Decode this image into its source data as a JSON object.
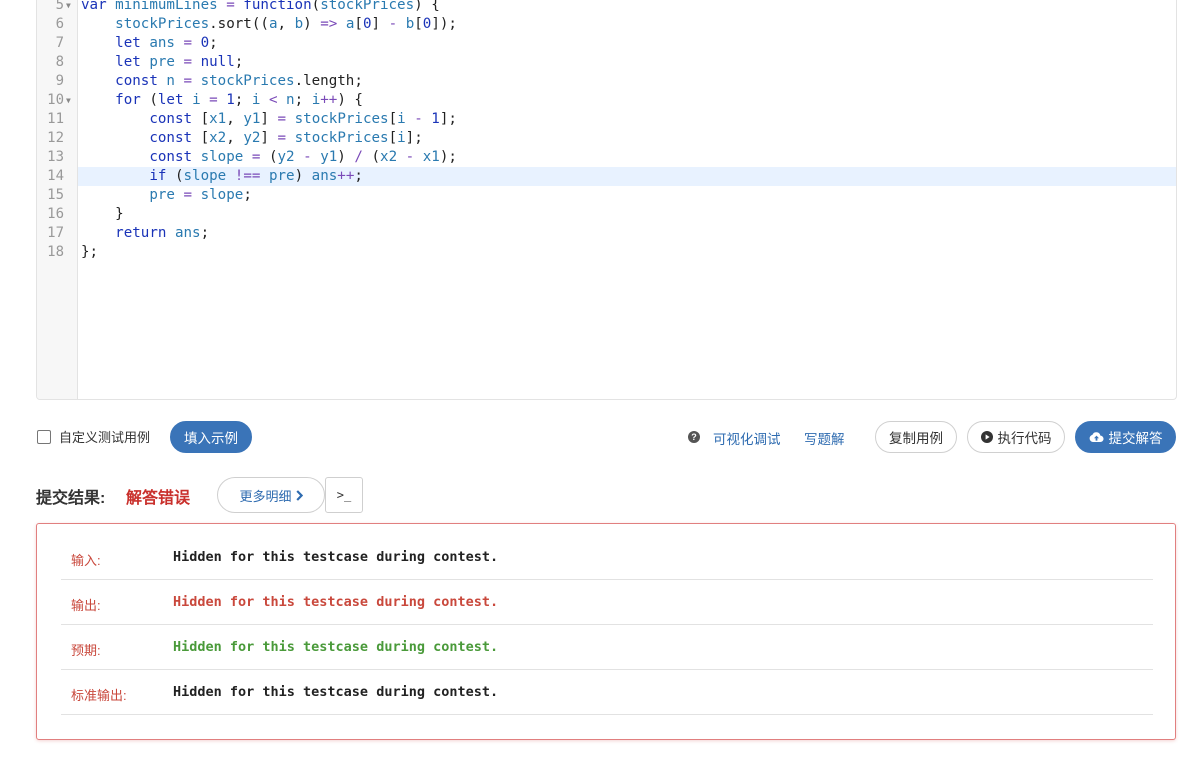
{
  "editor": {
    "active_line": 14,
    "lines": [
      {
        "no": "5",
        "fold": true,
        "tokens": [
          [
            "kw",
            "var "
          ],
          [
            "id",
            "minimumLines"
          ],
          [
            "op",
            " = "
          ],
          [
            "kw",
            "function"
          ],
          [
            "pl",
            "("
          ],
          [
            "id",
            "stockPrices"
          ],
          [
            "pl",
            ") {"
          ]
        ]
      },
      {
        "no": "6",
        "fold": false,
        "tokens": [
          [
            "pl",
            "    "
          ],
          [
            "id",
            "stockPrices"
          ],
          [
            "pl",
            ".sort(("
          ],
          [
            "id",
            "a"
          ],
          [
            "pl",
            ", "
          ],
          [
            "id",
            "b"
          ],
          [
            "pl",
            ") "
          ],
          [
            "op",
            "=>"
          ],
          [
            "pl",
            " "
          ],
          [
            "id",
            "a"
          ],
          [
            "pl",
            "["
          ],
          [
            "num",
            "0"
          ],
          [
            "pl",
            "] "
          ],
          [
            "op",
            "-"
          ],
          [
            "pl",
            " "
          ],
          [
            "id",
            "b"
          ],
          [
            "pl",
            "["
          ],
          [
            "num",
            "0"
          ],
          [
            "pl",
            "]);"
          ]
        ]
      },
      {
        "no": "7",
        "fold": false,
        "tokens": [
          [
            "pl",
            "    "
          ],
          [
            "kw",
            "let "
          ],
          [
            "id",
            "ans"
          ],
          [
            "op",
            " = "
          ],
          [
            "num",
            "0"
          ],
          [
            "pl",
            ";"
          ]
        ]
      },
      {
        "no": "8",
        "fold": false,
        "tokens": [
          [
            "pl",
            "    "
          ],
          [
            "kw",
            "let "
          ],
          [
            "id",
            "pre"
          ],
          [
            "op",
            " = "
          ],
          [
            "kw",
            "null"
          ],
          [
            "pl",
            ";"
          ]
        ]
      },
      {
        "no": "9",
        "fold": false,
        "tokens": [
          [
            "pl",
            "    "
          ],
          [
            "kw",
            "const "
          ],
          [
            "id",
            "n"
          ],
          [
            "op",
            " = "
          ],
          [
            "id",
            "stockPrices"
          ],
          [
            "pl",
            ".length;"
          ]
        ]
      },
      {
        "no": "10",
        "fold": true,
        "tokens": [
          [
            "pl",
            "    "
          ],
          [
            "kw",
            "for "
          ],
          [
            "pl",
            "("
          ],
          [
            "kw",
            "let "
          ],
          [
            "id",
            "i"
          ],
          [
            "op",
            " = "
          ],
          [
            "num",
            "1"
          ],
          [
            "pl",
            "; "
          ],
          [
            "id",
            "i"
          ],
          [
            "op",
            " < "
          ],
          [
            "id",
            "n"
          ],
          [
            "pl",
            "; "
          ],
          [
            "id",
            "i"
          ],
          [
            "op",
            "++"
          ],
          [
            "pl",
            ") {"
          ]
        ]
      },
      {
        "no": "11",
        "fold": false,
        "tokens": [
          [
            "pl",
            "        "
          ],
          [
            "kw",
            "const "
          ],
          [
            "pl",
            "["
          ],
          [
            "id",
            "x1"
          ],
          [
            "pl",
            ", "
          ],
          [
            "id",
            "y1"
          ],
          [
            "pl",
            "] "
          ],
          [
            "op",
            "="
          ],
          [
            "pl",
            " "
          ],
          [
            "id",
            "stockPrices"
          ],
          [
            "pl",
            "["
          ],
          [
            "id",
            "i"
          ],
          [
            "op",
            " - "
          ],
          [
            "num",
            "1"
          ],
          [
            "pl",
            "];"
          ]
        ]
      },
      {
        "no": "12",
        "fold": false,
        "tokens": [
          [
            "pl",
            "        "
          ],
          [
            "kw",
            "const "
          ],
          [
            "pl",
            "["
          ],
          [
            "id",
            "x2"
          ],
          [
            "pl",
            ", "
          ],
          [
            "id",
            "y2"
          ],
          [
            "pl",
            "] "
          ],
          [
            "op",
            "="
          ],
          [
            "pl",
            " "
          ],
          [
            "id",
            "stockPrices"
          ],
          [
            "pl",
            "["
          ],
          [
            "id",
            "i"
          ],
          [
            "pl",
            "];"
          ]
        ]
      },
      {
        "no": "13",
        "fold": false,
        "tokens": [
          [
            "pl",
            "        "
          ],
          [
            "kw",
            "const "
          ],
          [
            "id",
            "slope"
          ],
          [
            "op",
            " = "
          ],
          [
            "pl",
            "("
          ],
          [
            "id",
            "y2"
          ],
          [
            "op",
            " - "
          ],
          [
            "id",
            "y1"
          ],
          [
            "pl",
            ") "
          ],
          [
            "op",
            "/"
          ],
          [
            "pl",
            " ("
          ],
          [
            "id",
            "x2"
          ],
          [
            "op",
            " - "
          ],
          [
            "id",
            "x1"
          ],
          [
            "pl",
            ");"
          ]
        ]
      },
      {
        "no": "14",
        "fold": false,
        "tokens": [
          [
            "pl",
            "        "
          ],
          [
            "kw",
            "if "
          ],
          [
            "pl",
            "("
          ],
          [
            "id",
            "slope"
          ],
          [
            "op",
            " !== "
          ],
          [
            "id",
            "pre"
          ],
          [
            "pl",
            ") "
          ],
          [
            "id",
            "ans"
          ],
          [
            "op",
            "++"
          ],
          [
            "pl",
            ";"
          ]
        ]
      },
      {
        "no": "15",
        "fold": false,
        "tokens": [
          [
            "pl",
            "        "
          ],
          [
            "id",
            "pre"
          ],
          [
            "op",
            " = "
          ],
          [
            "id",
            "slope"
          ],
          [
            "pl",
            ";"
          ]
        ]
      },
      {
        "no": "16",
        "fold": false,
        "tokens": [
          [
            "pl",
            "    }"
          ]
        ]
      },
      {
        "no": "17",
        "fold": false,
        "tokens": [
          [
            "pl",
            "    "
          ],
          [
            "kw",
            "return "
          ],
          [
            "id",
            "ans"
          ],
          [
            "pl",
            ";"
          ]
        ]
      },
      {
        "no": "18",
        "fold": false,
        "tokens": [
          [
            "pl",
            "};"
          ]
        ]
      }
    ]
  },
  "toolbar": {
    "custom_test_label": "自定义测试用例",
    "fill_example_label": "填入示例",
    "help_icon": "question-circle-icon",
    "visual_debug_label": "可视化调试",
    "write_solution_label": "写题解",
    "copy_case_label": "复制用例",
    "run_code_label": "执行代码",
    "submit_label": "提交解答"
  },
  "result": {
    "label": "提交结果:",
    "status": "解答错误",
    "more_label": "更多明细",
    "terminal_label": ">_",
    "rows": [
      {
        "label": "输入:",
        "value": "Hidden for this testcase during contest.",
        "tone": "normal"
      },
      {
        "label": "输出:",
        "value": "Hidden for this testcase during contest.",
        "tone": "red"
      },
      {
        "label": "预期:",
        "value": "Hidden for this testcase during contest.",
        "tone": "green"
      },
      {
        "label": "标准输出:",
        "value": "Hidden for this testcase during contest.",
        "tone": "normal"
      }
    ]
  },
  "colors": {
    "primary": "#3a74b8",
    "error": "#c9302c",
    "success": "#4a9a3a",
    "link": "#2e6bb0",
    "active_line_bg": "#e8f2ff"
  }
}
